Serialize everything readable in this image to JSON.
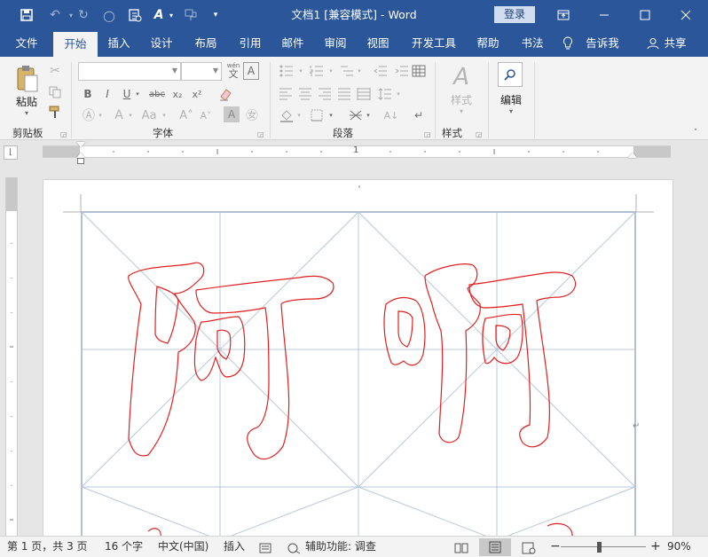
{
  "title_bar": {
    "title": "文档1 [兼容模式]  -  Word",
    "login_label": "登录",
    "qat_icons": [
      "save-icon",
      "undo-icon",
      "redo-icon",
      "circle-icon",
      "clipboard-doc-icon",
      "font-style-icon",
      "format-painter-icon",
      "customize-qat-icon"
    ]
  },
  "ribbon_tabs": [
    "文件",
    "开始",
    "插入",
    "设计",
    "布局",
    "引用",
    "邮件",
    "审阅",
    "视图",
    "开发工具",
    "帮助",
    "书法"
  ],
  "active_tab": "开始",
  "tell_me": "告诉我",
  "share": "共享",
  "clipboard_group": {
    "label": "剪贴板",
    "paste_label": "粘贴"
  },
  "font_group": {
    "label": "字体",
    "font_name": "",
    "font_size": "",
    "wen_label": "wén",
    "wen_char": "文",
    "a_char": "A"
  },
  "paragraph_group": {
    "label": "段落"
  },
  "styles_group": {
    "label": "样式",
    "styles_button": "样式"
  },
  "editing_group": {
    "label": "编辑"
  },
  "ruler": {
    "mark": "1"
  },
  "document": {
    "characters": [
      "阿",
      "啊"
    ],
    "cursor_mark": "↵"
  },
  "status_bar": {
    "page": "第 1 页，共 3 页",
    "words": "16 个字",
    "language": "中文(中国)",
    "mode": "插入",
    "accessibility": "辅助功能: 调查",
    "zoom": "90%",
    "zoom_level_percent": 90
  },
  "colors": {
    "accent": "#2b579a",
    "glyph_outline": "#e02020",
    "grid": "#b8c8dc"
  }
}
